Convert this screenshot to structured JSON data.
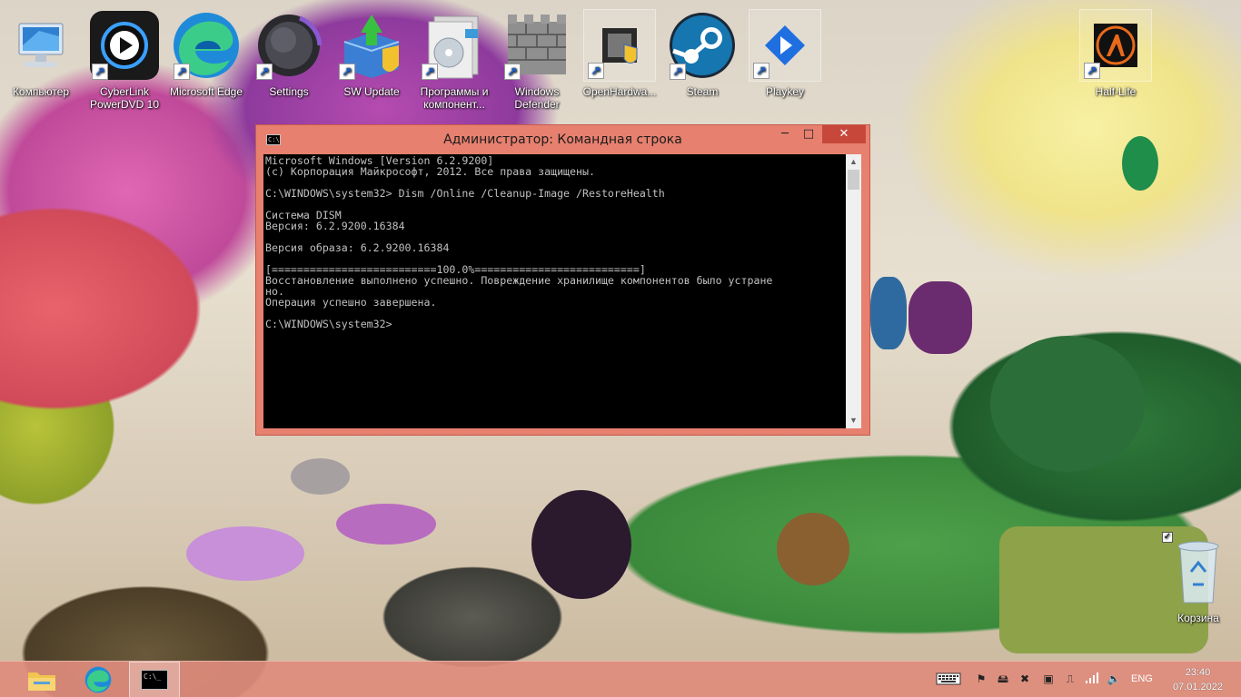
{
  "desktop": {
    "icons": [
      {
        "label": "Компьютер",
        "icon": "computer-icon"
      },
      {
        "label": "CyberLink PowerDVD 10",
        "icon": "powerdvd-icon"
      },
      {
        "label": "Microsoft Edge",
        "icon": "edge-icon"
      },
      {
        "label": "Settings",
        "icon": "settings-icon"
      },
      {
        "label": "SW Update",
        "icon": "sw-update-icon"
      },
      {
        "label": "Программы и компонент...",
        "icon": "programs-icon"
      },
      {
        "label": "Windows Defender",
        "icon": "defender-icon"
      },
      {
        "label": "OpenHardwa...",
        "icon": "openhardware-icon"
      },
      {
        "label": "Steam",
        "icon": "steam-icon"
      },
      {
        "label": "Playkey",
        "icon": "playkey-icon"
      },
      {
        "label": "Half-Life",
        "icon": "halflife-icon"
      },
      {
        "label": "Корзина",
        "icon": "recycle-bin-icon"
      }
    ]
  },
  "window": {
    "title": "Администратор: Командная строка",
    "console_lines": [
      "Microsoft Windows [Version 6.2.9200]",
      "(c) Корпорация Майкрософт, 2012. Все права защищены.",
      "",
      "C:\\WINDOWS\\system32> Dism /Online /Cleanup-Image /RestoreHealth",
      "",
      "Система DISM",
      "Версия: 6.2.9200.16384",
      "",
      "Версия образа: 6.2.9200.16384",
      "",
      "[==========================100.0%==========================]",
      "Восстановление выполнено успешно. Повреждение хранилище компонентов было устране",
      "но.",
      "Операция успешно завершена.",
      "",
      "C:\\WINDOWS\\system32>"
    ],
    "minimize": "─",
    "maximize": "□",
    "close": "✕"
  },
  "taskbar": {
    "language": "ENG",
    "time": "23:40",
    "date": "07.01.2022"
  }
}
